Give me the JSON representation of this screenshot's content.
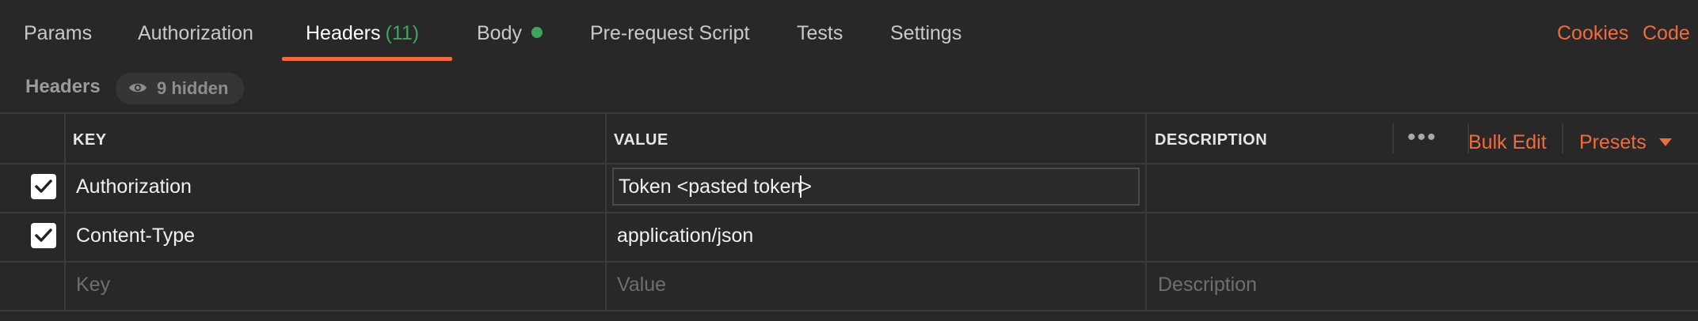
{
  "tabs": {
    "params": "Params",
    "authorization": "Authorization",
    "headers": "Headers",
    "headers_count": "(11)",
    "body": "Body",
    "prerequest": "Pre-request Script",
    "tests": "Tests",
    "settings": "Settings"
  },
  "right_links": {
    "cookies": "Cookies",
    "code": "Code"
  },
  "subheader": {
    "title": "Headers",
    "hidden": "9 hidden"
  },
  "table": {
    "columns": {
      "key": "KEY",
      "value": "VALUE",
      "description": "DESCRIPTION"
    },
    "actions": {
      "more": "•••",
      "bulk_edit": "Bulk Edit",
      "presets": "Presets"
    },
    "rows": [
      {
        "checked": true,
        "key": "Authorization",
        "value_before_caret": "Token <pasted token",
        "value_after_caret": ">",
        "description": ""
      },
      {
        "checked": true,
        "key": "Content-Type",
        "value": "application/json",
        "description": ""
      }
    ],
    "placeholders": {
      "key": "Key",
      "value": "Value",
      "description": "Description"
    }
  },
  "colors": {
    "accent": "#f26b3a",
    "success": "#3fa55a",
    "background": "#282828"
  }
}
